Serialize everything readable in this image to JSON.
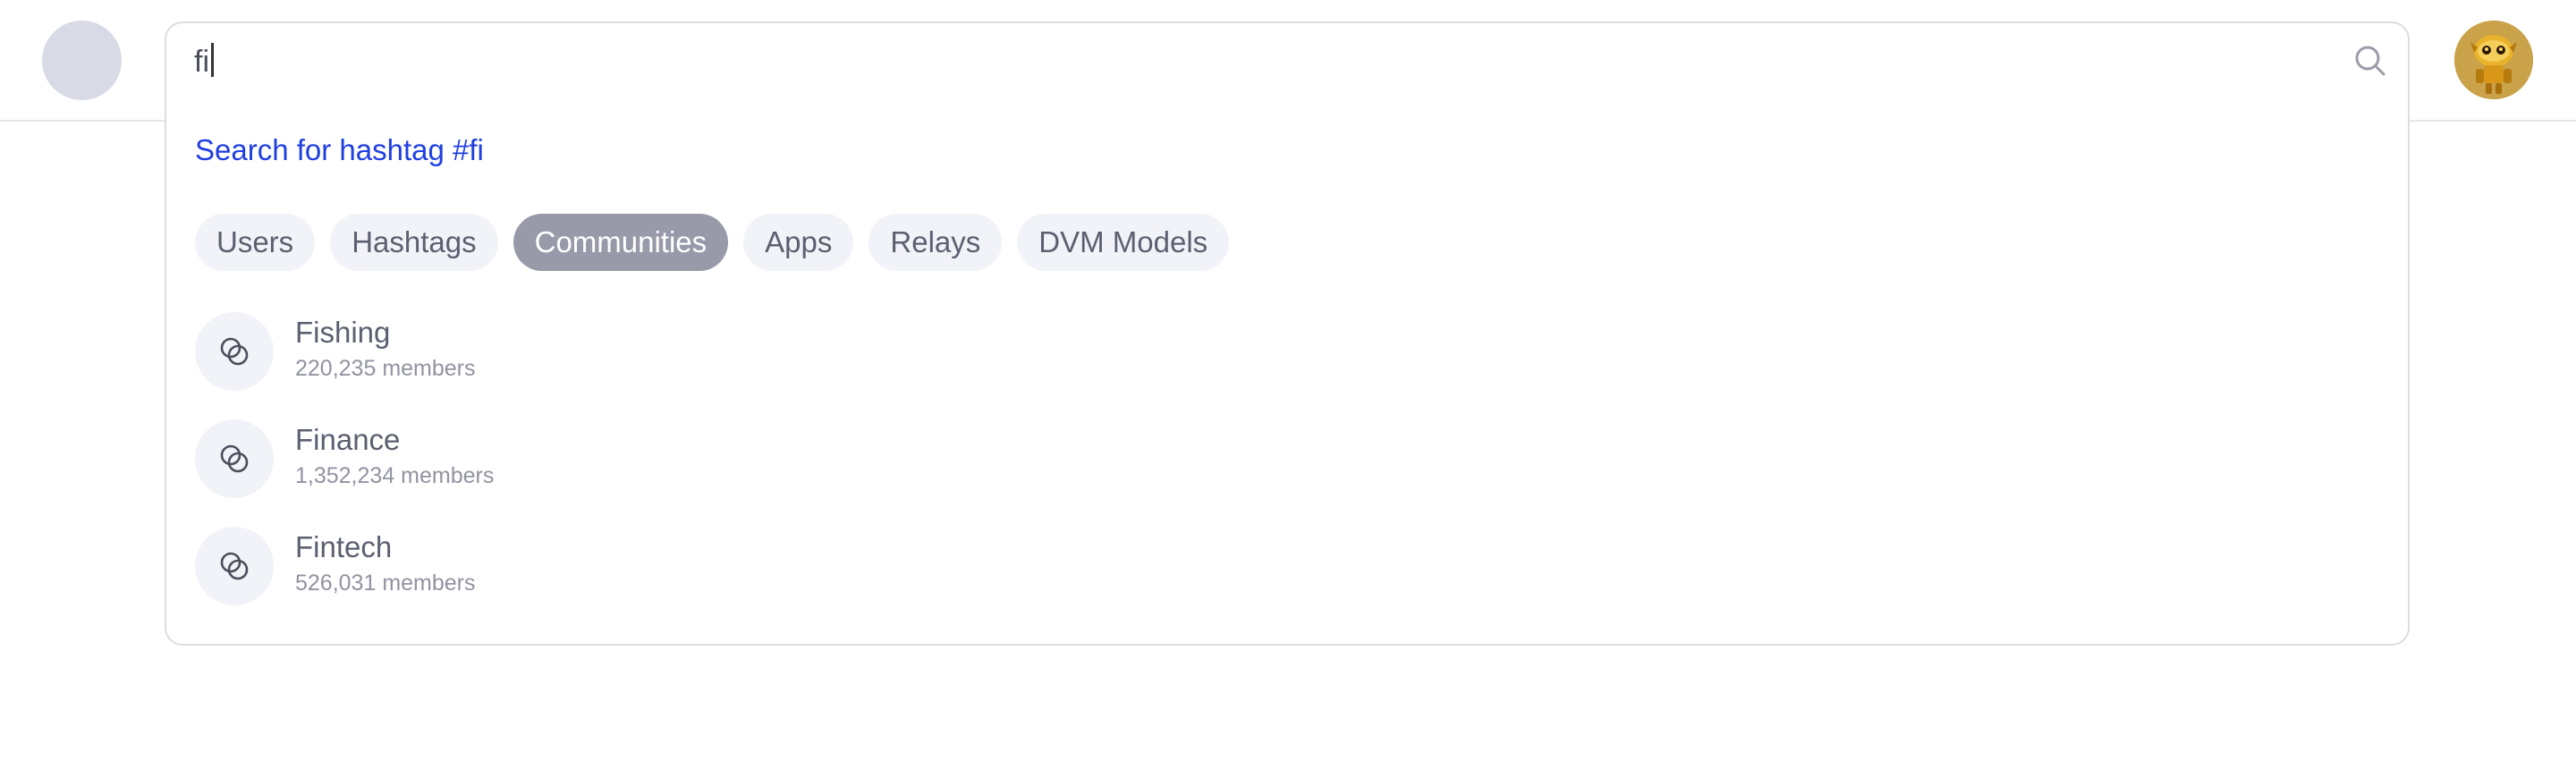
{
  "search": {
    "value": "fi",
    "hashtag_prompt": "Search for hashtag #fi"
  },
  "filters": [
    {
      "label": "Users",
      "active": false
    },
    {
      "label": "Hashtags",
      "active": false
    },
    {
      "label": "Communities",
      "active": true
    },
    {
      "label": "Apps",
      "active": false
    },
    {
      "label": "Relays",
      "active": false
    },
    {
      "label": "DVM Models",
      "active": false
    }
  ],
  "results": [
    {
      "name": "Fishing",
      "members": "220,235 members",
      "icon": "community-icon"
    },
    {
      "name": "Finance",
      "members": "1,352,234 members",
      "icon": "community-icon"
    },
    {
      "name": "Fintech",
      "members": "526,031 members",
      "icon": "community-icon"
    }
  ],
  "colors": {
    "link": "#1f3fe0",
    "active_chip": "#999aa9",
    "chip_bg": "#f2f3f8"
  },
  "icons": {
    "search": "search-icon",
    "logo": "logo-placeholder",
    "avatar": "user-avatar"
  }
}
